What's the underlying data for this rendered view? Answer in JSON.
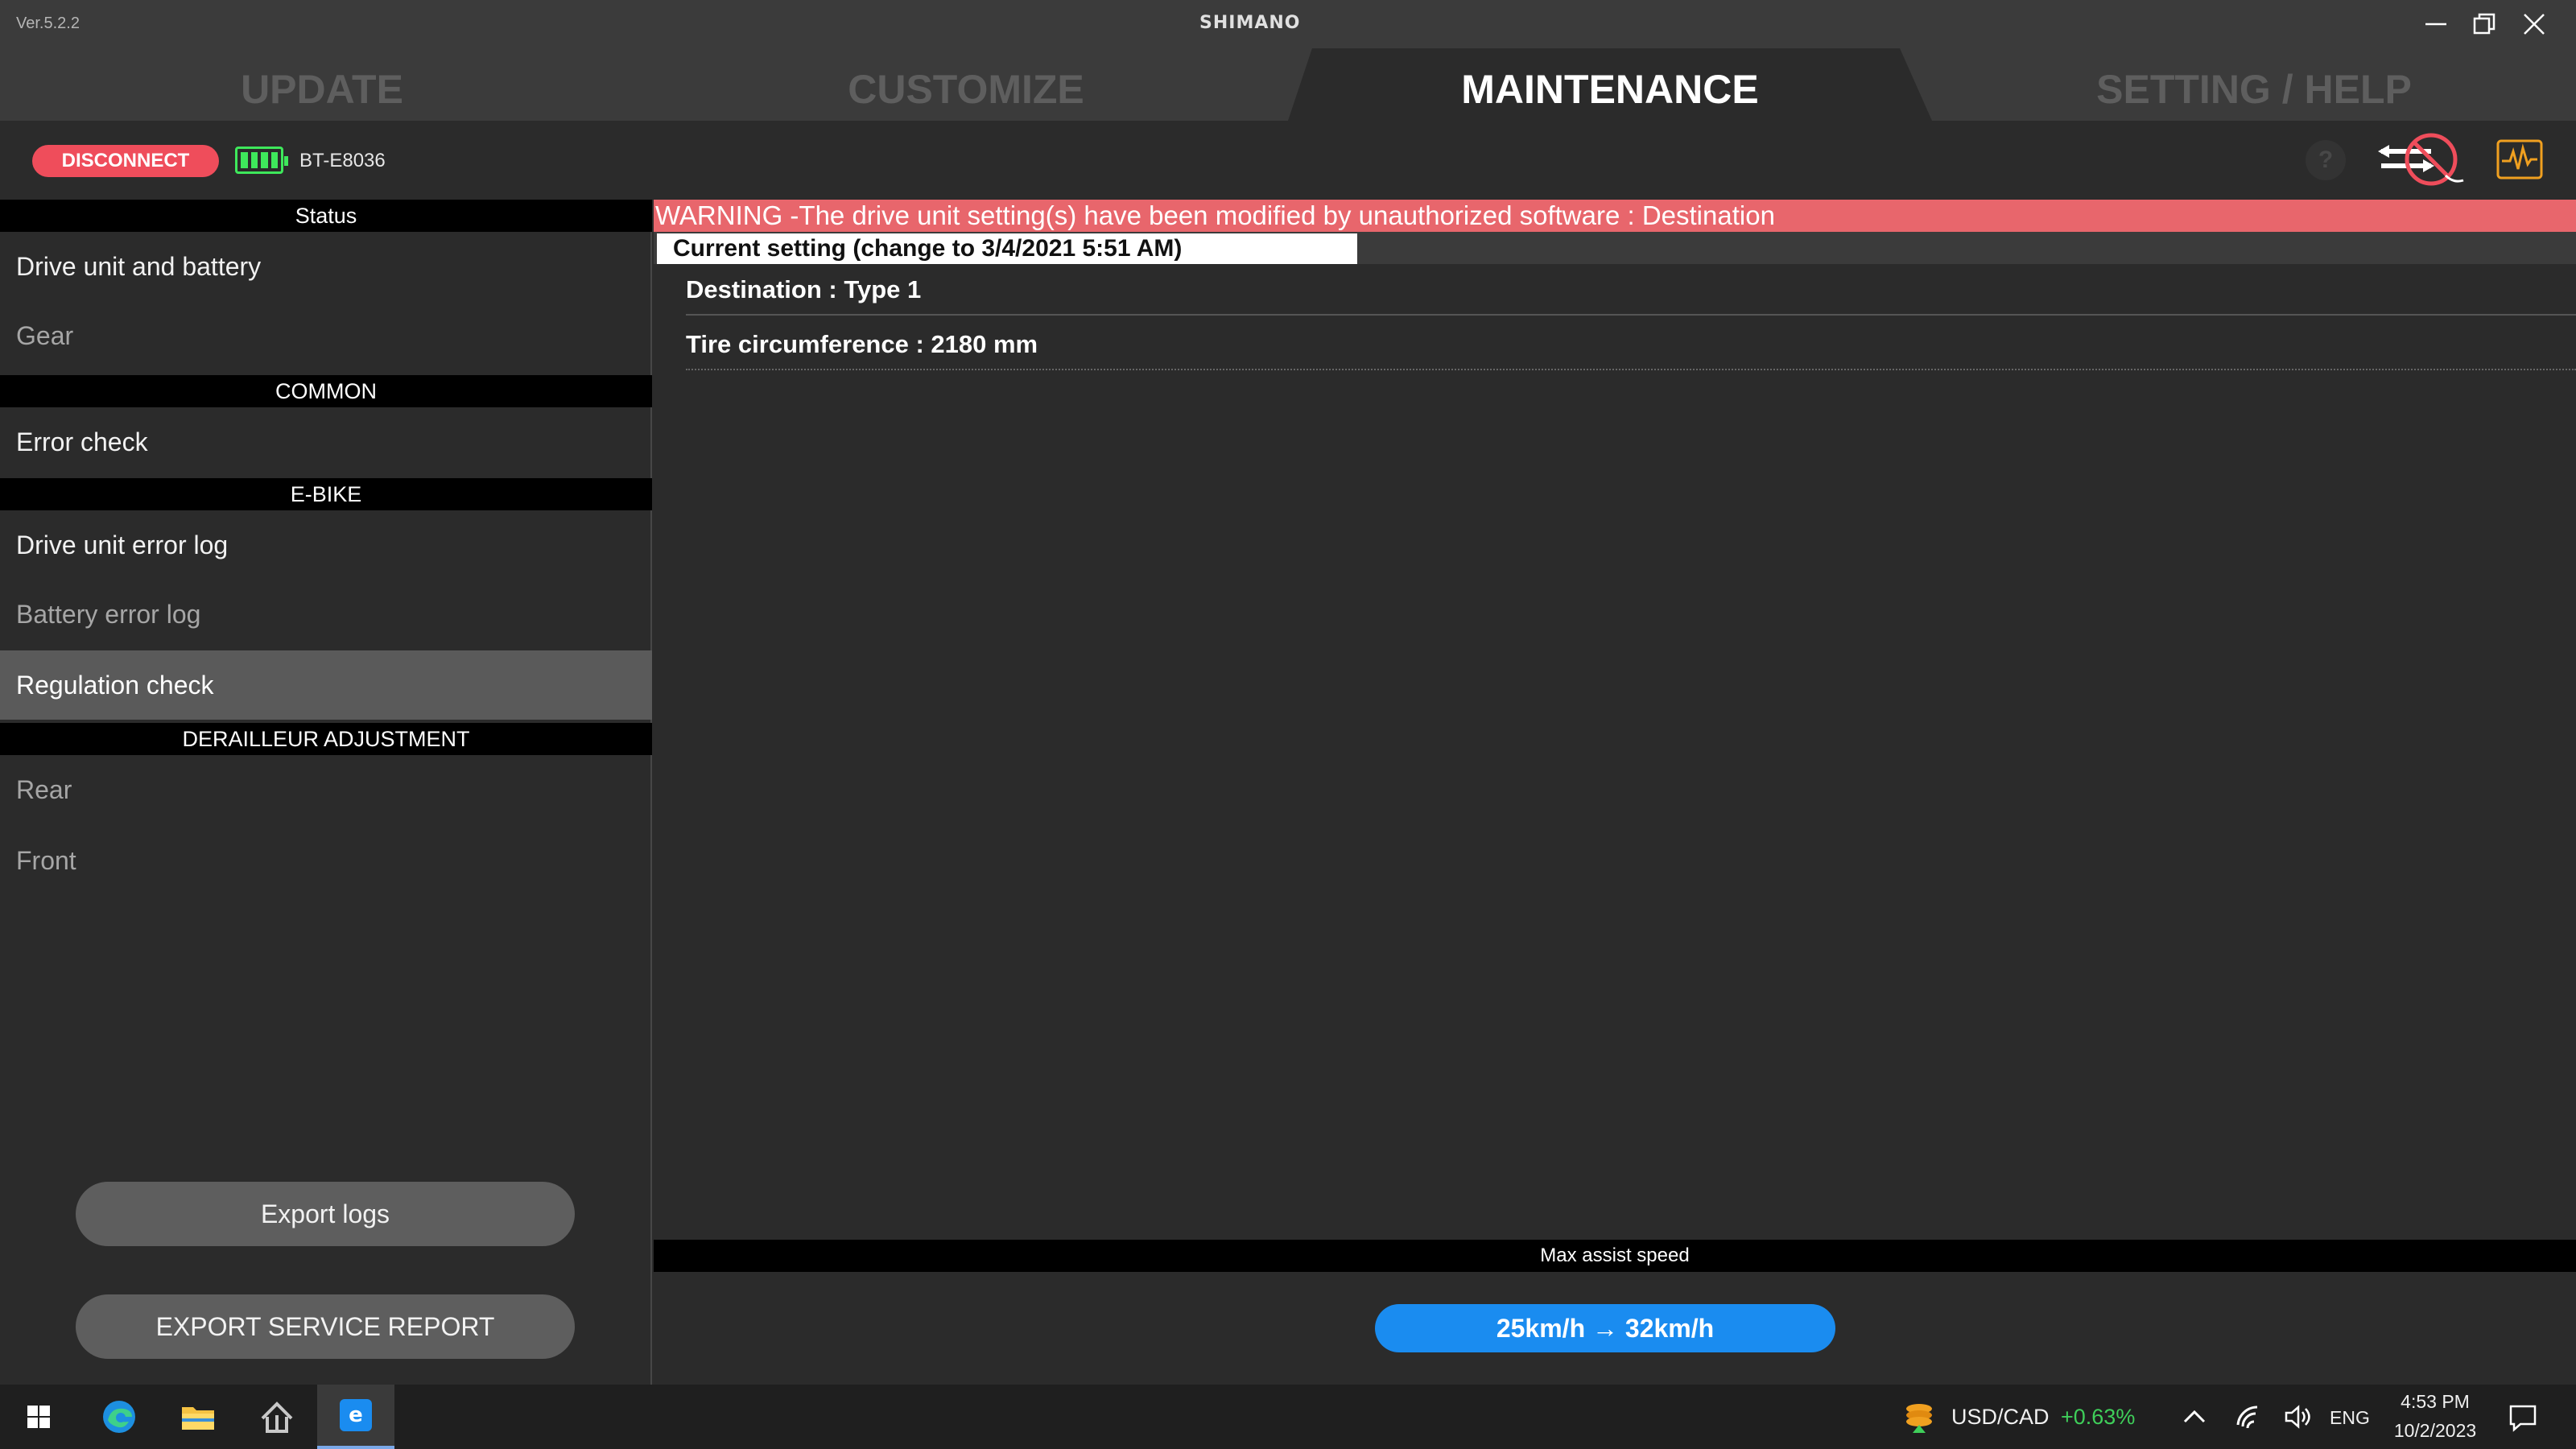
{
  "window": {
    "version": "Ver.5.2.2",
    "brand": "SHIMANO"
  },
  "tabs": [
    {
      "label": "UPDATE",
      "active": false
    },
    {
      "label": "CUSTOMIZE",
      "active": false
    },
    {
      "label": "MAINTENANCE",
      "active": true
    },
    {
      "label": "SETTING / HELP",
      "active": false
    }
  ],
  "toolbar": {
    "disconnect_label": "DISCONNECT",
    "device_name": "BT-E8036",
    "help_label": "?"
  },
  "sidebar": {
    "status_header": "Status",
    "status_items": [
      "Drive unit and battery",
      "Gear"
    ],
    "common_header": "COMMON",
    "common_items": [
      "Error check"
    ],
    "ebike_header": "E-BIKE",
    "ebike_items": [
      "Drive unit error log",
      "Battery error log",
      "Regulation check"
    ],
    "derailleur_header": "DERAILLEUR ADJUSTMENT",
    "derailleur_items": [
      "Rear",
      "Front"
    ],
    "export_logs_label": "Export logs",
    "export_report_label": "EXPORT SERVICE REPORT"
  },
  "main": {
    "warning": "WARNING -The drive unit setting(s) have been modified by unauthorized software : Destination",
    "current_setting": "Current setting (change to 3/4/2021 5:51 AM)",
    "rows": [
      "Destination : Type 1",
      "Tire circumference : 2180 mm"
    ],
    "max_assist_header": "Max assist speed",
    "max_assist_value": "25km/h → 32km/h"
  },
  "taskbar": {
    "currency_pair": "USD/CAD",
    "currency_change": "+0.63%",
    "language": "ENG",
    "time": "4:53 PM",
    "date": "10/2/2023"
  },
  "colors": {
    "warning_bg": "#e8666c",
    "disconnect_bg": "#ef4d5b",
    "battery": "#3ee85b",
    "accent_blue": "#1a8cf0",
    "wave_icon": "#f0a020"
  }
}
